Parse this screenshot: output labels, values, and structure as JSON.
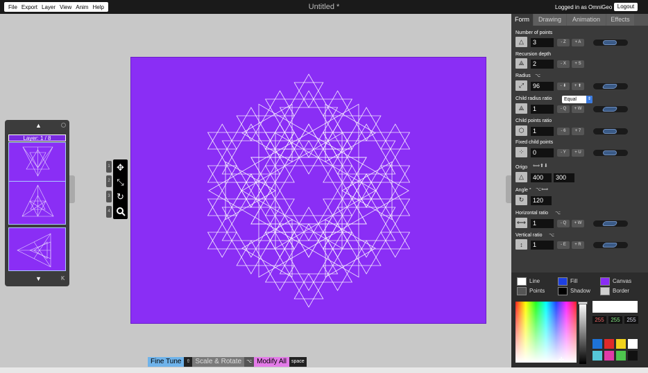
{
  "menu": [
    "File",
    "Export",
    "Layer",
    "View",
    "Anim",
    "Help"
  ],
  "document_title": "Untitled *",
  "login": {
    "text": "Logged in as OmniGeo",
    "logout_label": "Logout"
  },
  "layers": {
    "counter": "Layer: 1 / 8",
    "shortcut": "K"
  },
  "tool_keys": [
    "1",
    "2",
    "3",
    "4"
  ],
  "tabs": [
    {
      "label": "Form",
      "active": true
    },
    {
      "label": "Drawing",
      "active": false
    },
    {
      "label": "Animation",
      "active": false
    },
    {
      "label": "Effects",
      "active": false
    }
  ],
  "form": {
    "number_of_points": {
      "label": "Number of points",
      "value": "3",
      "minus": "- Z",
      "plus": "+ A"
    },
    "recursion_depth": {
      "label": "Recursion depth",
      "value": "2",
      "minus": "- X",
      "plus": "+ S"
    },
    "radius": {
      "label": "Radius",
      "value": "96",
      "minus": "- ⬇",
      "plus": "+ ⬆"
    },
    "child_radius_ratio": {
      "label": "Child radius ratio",
      "select": "Equal",
      "value": "1",
      "minus": "- Q",
      "plus": "+ W"
    },
    "child_points_ratio": {
      "label": "Child points ratio",
      "value": "1",
      "minus": "- 6",
      "plus": "+ 7"
    },
    "fixed_child_points": {
      "label": "Fixed child points",
      "value": "0",
      "minus": "- Y",
      "plus": "+ U"
    },
    "origo": {
      "label": "Origo",
      "x": "400",
      "y": "300"
    },
    "angle": {
      "label": "Angle °",
      "value": "120"
    },
    "horizontal_ratio": {
      "label": "Horizontal ratio",
      "value": "1",
      "minus": "- Q",
      "plus": "+ W"
    },
    "vertical_ratio": {
      "label": "Vertical ratio",
      "value": "1",
      "minus": "- E",
      "plus": "+ R"
    }
  },
  "colors": {
    "line": {
      "label": "Line",
      "color": "#ffffff"
    },
    "fill": {
      "label": "Fill",
      "color": "#1e40e0"
    },
    "canvas": {
      "label": "Canvas",
      "color": "#8a2ef5"
    },
    "points": {
      "label": "Points",
      "color": "#555555"
    },
    "shadow": {
      "label": "Shadow",
      "color": "#000000"
    },
    "border": {
      "label": "Border",
      "color": "#cfcfcf"
    },
    "rgb": [
      "255",
      "255",
      "255"
    ],
    "palette": [
      "#1e73d8",
      "#e02a2a",
      "#f2d21c",
      "#ffffff",
      "#55c7d8",
      "#e03aa8",
      "#4ec44e",
      "#111111"
    ]
  },
  "modes": [
    {
      "label": "Fine Tune",
      "key": "⇧",
      "color": "#6fb3ea"
    },
    {
      "label": "Scale & Rotate",
      "key": "⌥",
      "color": "#7a7a7a"
    },
    {
      "label": "Modify All",
      "key": "space",
      "color": "#e37be8"
    }
  ]
}
